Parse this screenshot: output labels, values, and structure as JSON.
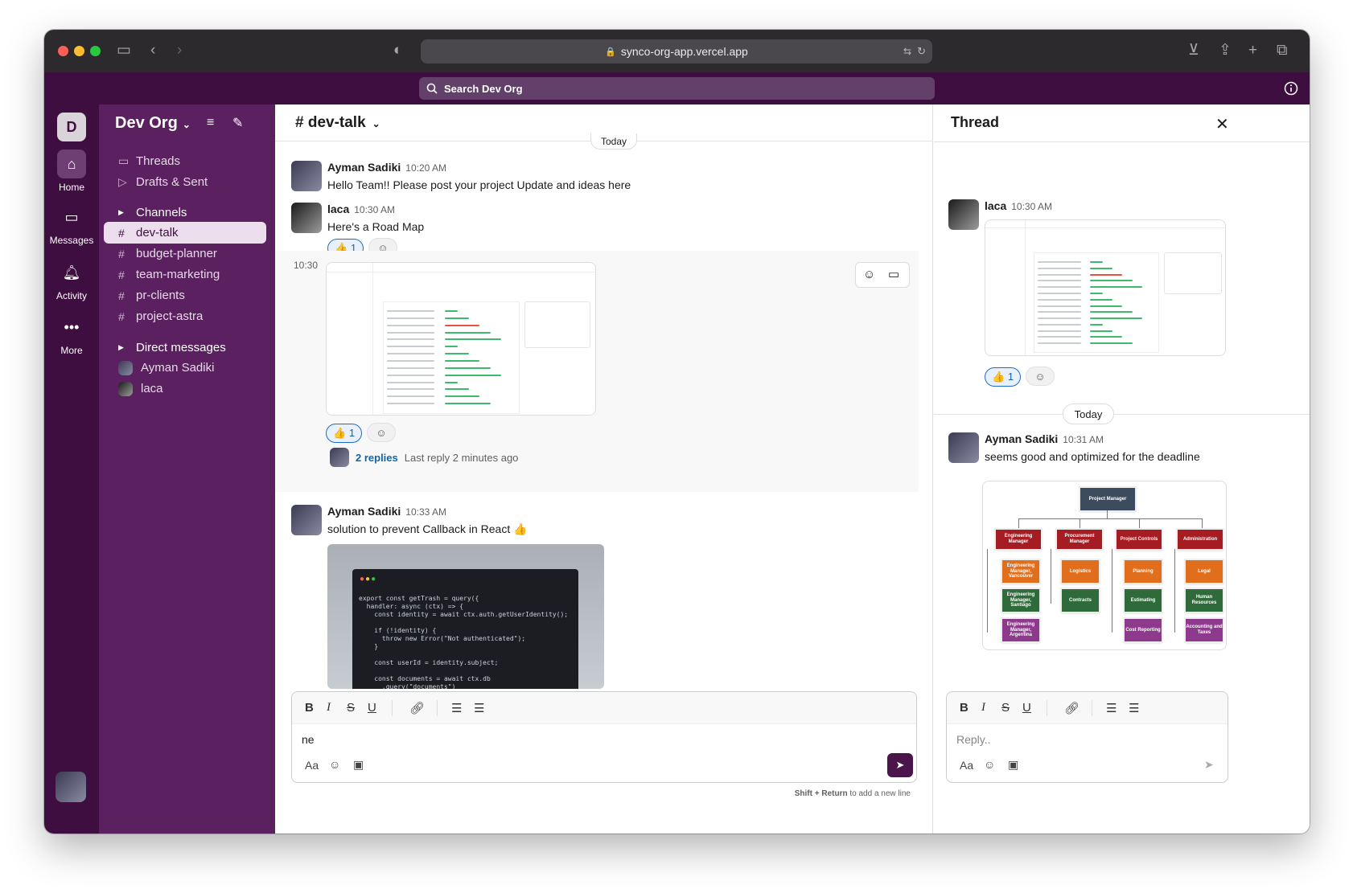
{
  "browser": {
    "url": "synco-org-app.vercel.app"
  },
  "app": {
    "search_placeholder": "Search Dev Org"
  },
  "rail": {
    "workspace_initial": "D",
    "items": [
      {
        "label": "Home",
        "icon": "home-icon"
      },
      {
        "label": "Messages",
        "icon": "messages-icon"
      },
      {
        "label": "Activity",
        "icon": "bell-icon"
      },
      {
        "label": "More",
        "icon": "more-icon"
      }
    ]
  },
  "sidebar": {
    "workspace_name": "Dev Org",
    "threads_label": "Threads",
    "drafts_label": "Drafts & Sent",
    "channels_label": "Channels",
    "channels": [
      "dev-talk",
      "budget-planner",
      "team-marketing",
      "pr-clients",
      "project-astra"
    ],
    "active_channel": "dev-talk",
    "dm_label": "Direct messages",
    "dms": [
      "Ayman Sadiki",
      "laca"
    ]
  },
  "channel": {
    "title": "# dev-talk",
    "day_divider": "Today",
    "messages": [
      {
        "author": "Ayman Sadiki",
        "time": "10:20 AM",
        "text": "Hello Team!! Please post your project Update and ideas here"
      },
      {
        "author": "laca",
        "time": "10:30 AM",
        "text": "Here's a Road Map",
        "reaction": "👍",
        "reaction_count": "1"
      },
      {
        "time": "10:30",
        "reaction": "👍",
        "reaction_count": "1",
        "replies": "2 replies",
        "last_reply": "Last reply 2 minutes ago"
      },
      {
        "author": "Ayman Sadiki",
        "time": "10:33 AM",
        "text": "solution to prevent Callback in React 👍"
      }
    ],
    "composer_text": "ne",
    "hint_bold": "Shift + Return",
    "hint_rest": "to add a new line"
  },
  "thread": {
    "title": "Thread",
    "parent": {
      "author": "laca",
      "time": "10:30 AM",
      "reaction": "👍",
      "reaction_count": "1"
    },
    "day_divider": "Today",
    "reply": {
      "author": "Ayman Sadiki",
      "time": "10:31 AM",
      "text": "seems good and optimized for the deadline"
    },
    "reply_placeholder": "Reply..",
    "org_chart": {
      "top": "Project Manager",
      "columns": [
        [
          "Engineering Manager",
          "Engineering Manager, Vancouver",
          "Engineering Manager, Santiago",
          "Engineering Manager, Argentina"
        ],
        [
          "Procurement Manager",
          "Logistics",
          "Contracts"
        ],
        [
          "Project Controls",
          "Planning",
          "Estimating",
          "Cost Reporting"
        ],
        [
          "Administration",
          "Legal",
          "Human Resources",
          "Accounting and Taxes"
        ]
      ]
    }
  },
  "code_snippet": "export const getTrash = query({\n  handler: async (ctx) => {\n    const identity = await ctx.auth.getUserIdentity();\n\n    if (!identity) {\n      throw new Error(\"Not authenticated\");\n    }\n\n    const userId = identity.subject;\n\n    const documents = await ctx.db\n      .query(\"documents\")",
  "colors": {
    "aubergine": "#3f0e40",
    "sidebar": "#5b2060",
    "send": "#4a154b",
    "link": "#1264a3"
  }
}
